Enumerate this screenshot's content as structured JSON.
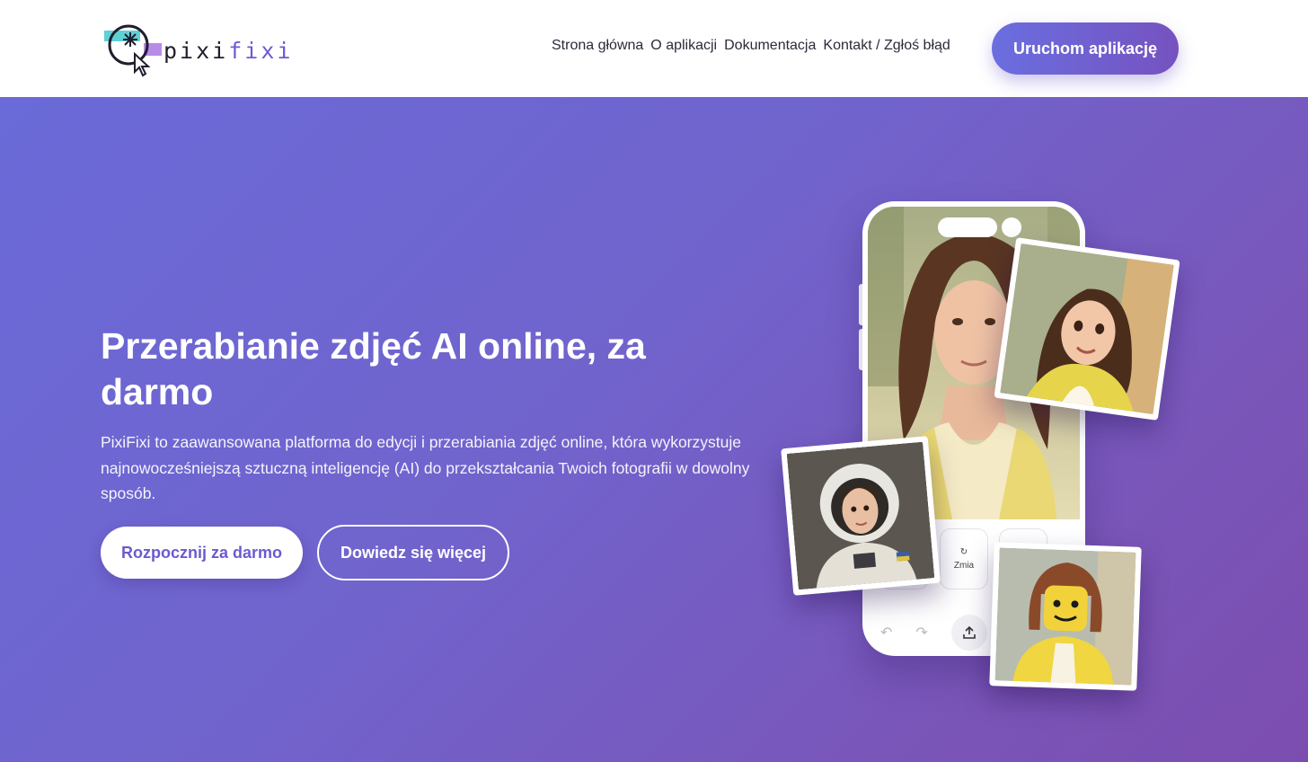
{
  "header": {
    "logo_text_part1": "pixi",
    "logo_text_part2": "fixi",
    "nav": [
      {
        "label": "Strona główna"
      },
      {
        "label": "O aplikacji"
      },
      {
        "label": "Dokumentacja"
      },
      {
        "label": "Kontakt / Zgłoś błąd"
      }
    ],
    "cta_label": "Uruchom aplikację"
  },
  "hero": {
    "title": "Przerabianie zdjęć AI online, za darmo",
    "description": "PixiFixi to zaawansowana platforma do edycji i przerabiania zdjęć online, która wykorzystuje najnowocześniejszą sztuczną inteligencję (AI) do przekształcania Twoich fotografii w dowolny sposób.",
    "primary_button": "Rozpocznij za darmo",
    "secondary_button": "Dowiedz się więcej"
  },
  "phone": {
    "tool_label": "Zmia",
    "icons": [
      "undo-icon",
      "redo-icon",
      "share-icon"
    ]
  },
  "colors": {
    "accent": "#6d5bd6",
    "hero_gradient_start": "#6a6ad8",
    "hero_gradient_end": "#7c4db0",
    "cta_gradient_start": "#6a6ee0",
    "cta_gradient_end": "#7652c0"
  }
}
